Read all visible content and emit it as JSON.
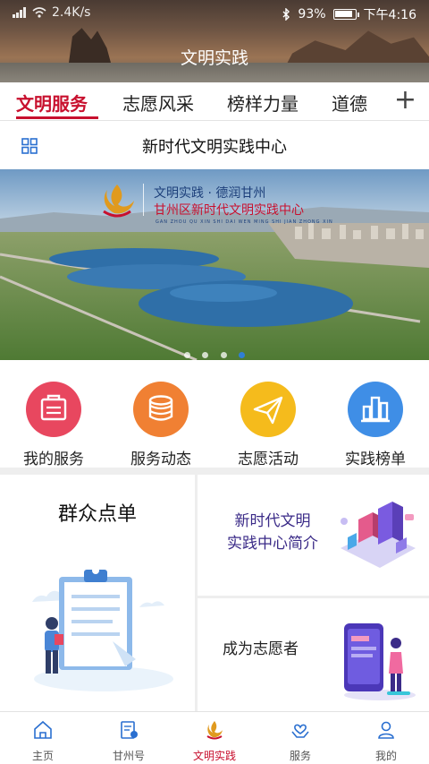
{
  "status_bar": {
    "left_text": "2.4K/s",
    "battery_percent": "93%",
    "battery_level": 0.93,
    "time": "下午4:16"
  },
  "header": {
    "title": "文明实践"
  },
  "tabs": {
    "items": [
      {
        "label": "文明服务",
        "active": true
      },
      {
        "label": "志愿风采",
        "active": false
      },
      {
        "label": "榜样力量",
        "active": false
      },
      {
        "label": "道德",
        "active": false
      }
    ],
    "add_label": "+"
  },
  "center_bar": {
    "title": "新时代文明实践中心"
  },
  "banner": {
    "line1": "文明实践 · 德润甘州",
    "line2": "甘州区新时代文明实践中心",
    "line3": "GAN ZHOU QU XIN SHI DAI WEN MING SHI JIAN ZHONG XIN",
    "slide_count": 4,
    "active_slide": 3
  },
  "services": [
    {
      "label": "我的服务",
      "icon": "service-box-icon",
      "color": "#e8475f"
    },
    {
      "label": "服务动态",
      "icon": "coins-icon",
      "color": "#f08033"
    },
    {
      "label": "志愿活动",
      "icon": "paper-plane-icon",
      "color": "#f5bb1c"
    },
    {
      "label": "实践榜单",
      "icon": "bar-chart-icon",
      "color": "#3f8ee6"
    }
  ],
  "cards": {
    "left": {
      "title": "群众点单"
    },
    "right_top": {
      "line1": "新时代文明",
      "line2": "实践中心简介"
    },
    "right_bottom": {
      "title": "成为志愿者"
    }
  },
  "bottom_nav": [
    {
      "label": "主页",
      "icon": "home-icon",
      "active": false
    },
    {
      "label": "甘州号",
      "icon": "document-icon",
      "active": false
    },
    {
      "label": "文明实践",
      "icon": "flame-logo-icon",
      "active": true
    },
    {
      "label": "服务",
      "icon": "hands-heart-icon",
      "active": false
    },
    {
      "label": "我的",
      "icon": "user-icon",
      "active": false
    }
  ],
  "colors": {
    "accent_red": "#c8102e",
    "dot_active": "#2f7fd6",
    "card_title_purple": "#3b2b88"
  }
}
